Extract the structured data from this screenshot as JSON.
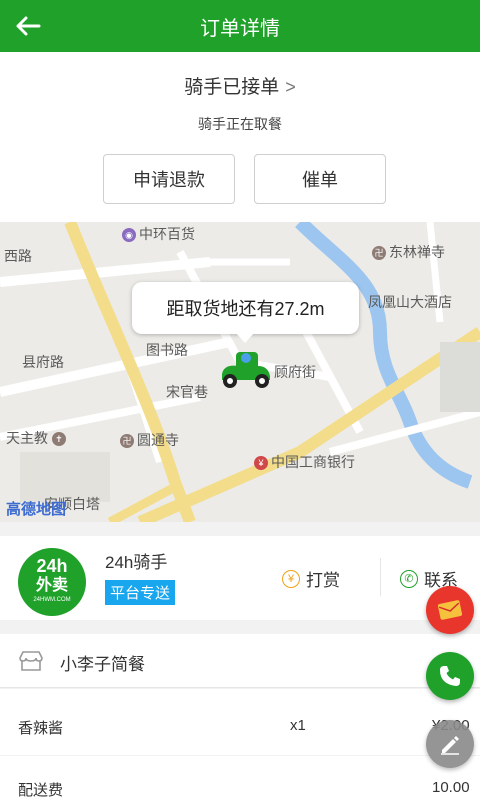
{
  "header": {
    "title": "订单详情"
  },
  "status": {
    "main": "骑手已接单",
    "sub": "骑手正在取餐",
    "chevron": ">"
  },
  "actions": {
    "refund_label": "申请退款",
    "urge_label": "催单"
  },
  "map": {
    "bubble_text": "距取货地还有27.2m",
    "labels": {
      "zhonghuan": "中环百货",
      "donglin": "东林禅寺",
      "xilu": "西路",
      "fenghuang": "凤凰山大酒店",
      "tushulu": "图书路",
      "xianfulu": "县府路",
      "gufujie": "顾府街",
      "songguanxiang": "宋官巷",
      "tianzhujiao": "天主教",
      "yuantongsi": "圆通寺",
      "icbc": "中国工商银行",
      "anshunbaita": "安顺白塔"
    },
    "brand": "高德地图"
  },
  "rider": {
    "logo_line1": "24h",
    "logo_line2": "外卖",
    "logo_line3": "24HWM.COM",
    "name": "24h骑手",
    "tag": "平台专送",
    "tip_label": "打赏",
    "contact_label": "联系"
  },
  "shop": {
    "name": "小李子简餐"
  },
  "items": [
    {
      "name": "香辣酱",
      "qty": "x1",
      "price": "¥2.00"
    }
  ],
  "delivery_fee": {
    "label": "配送费",
    "value": "10.00"
  },
  "colors": {
    "brand_green": "#1fa12a",
    "tag_blue": "#18a6ef",
    "red_packet": "#e8362c"
  }
}
